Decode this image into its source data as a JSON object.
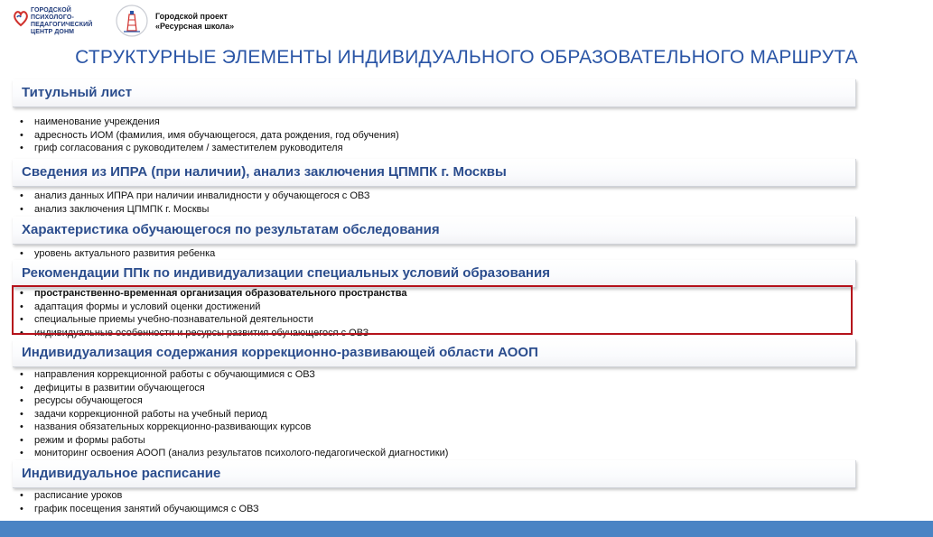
{
  "header": {
    "center_name": [
      "ГОРОДСКОЙ",
      "ПСИХОЛОГО-",
      "ПЕДАГОГИЧЕСКИЙ",
      "ЦЕНТР ДОНМ"
    ],
    "project_line1": "Городской проект",
    "project_line2": "«Ресурсная школа»"
  },
  "title": "СТРУКТУРНЫЕ ЭЛЕМЕНТЫ ИНДИВИДУАЛЬНОГО ОБРАЗОВАТЕЛЬНОГО МАРШРУТА",
  "sections": [
    {
      "heading": "Титульный лист",
      "items": [
        "наименование учреждения",
        "адресность ИОМ (фамилия, имя обучающегося, дата рождения, год обучения)",
        "гриф согласования с руководителем / заместителем руководителя"
      ]
    },
    {
      "heading": "Сведения из ИПРА (при наличии), анализ заключения ЦПМПК г. Москвы",
      "items": [
        "анализ данных ИПРА при наличии инвалидности у обучающегося с ОВЗ",
        "анализ заключения ЦПМПК г. Москвы"
      ]
    },
    {
      "heading": "Характеристика обучающегося по результатам обследования",
      "items": [
        "уровень актуального развития ребенка"
      ]
    },
    {
      "heading": "Рекомендации ППк по индивидуализации специальных условий образования",
      "items": [
        "пространственно-временная организация образовательного пространства",
        "адаптация формы и условий оценки достижений",
        "специальные приемы учебно-познавательной деятельности",
        "индивидуальные особенности и ресурсы развития обучающегося с ОВЗ"
      ]
    },
    {
      "heading": "Индивидуализация содержания коррекционно-развивающей области АООП",
      "items": [
        "направления коррекционной работы с обучающимися с ОВЗ",
        "дефициты в развитии обучающегося",
        "ресурсы обучающегося",
        "задачи коррекционной работы на учебный период",
        "названия обязательных коррекционно-развивающих курсов",
        "режим и формы работы",
        "мониторинг освоения АООП (анализ результатов психолого-педагогической диагностики)"
      ]
    },
    {
      "heading": "Индивидуальное расписание",
      "items": [
        "расписание уроков",
        "график посещения занятий обучающимся с ОВЗ"
      ]
    }
  ],
  "colors": {
    "title": "#2a55a6",
    "section_heading": "#2b4d8d",
    "highlight_border": "#b5121b",
    "bottom_bar": "#4a84c4"
  }
}
